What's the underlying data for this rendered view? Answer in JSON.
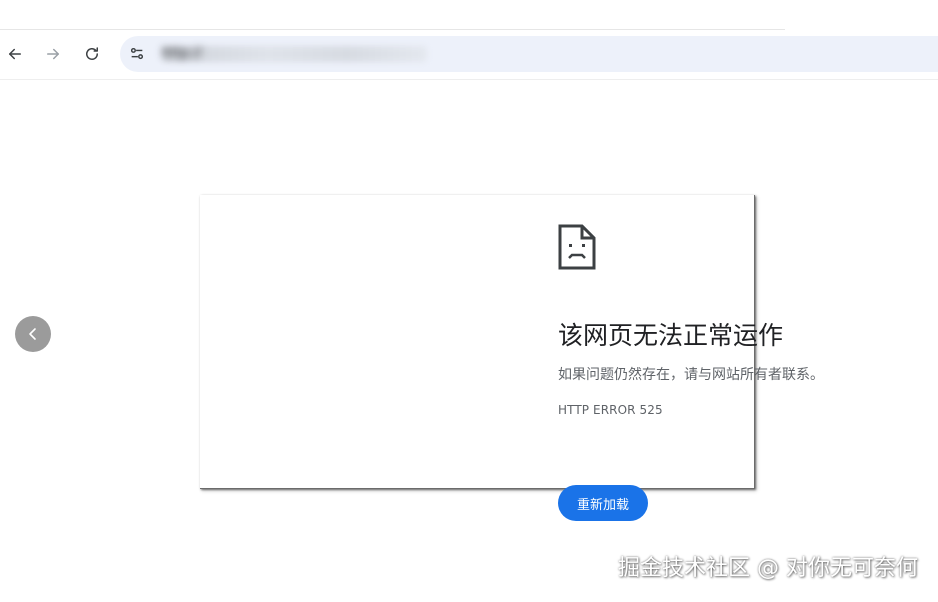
{
  "browser": {
    "address_bar": {
      "url": "http://"
    },
    "nav": {
      "back_icon": "arrow-left-icon",
      "forward_icon": "arrow-right-icon",
      "reload_icon": "reload-icon",
      "site_info_icon": "tune-icon"
    }
  },
  "error_page": {
    "icon": "sad-document-icon",
    "title": "该网页无法正常运作",
    "subtitle": "如果问题仍然存在，请与网站所有者联系。",
    "error_code": "HTTP ERROR 525",
    "reload_button_label": "重新加载",
    "reload_button_color": "#1a73e8"
  },
  "viewer": {
    "prev_icon": "chevron-left-icon"
  },
  "watermark": {
    "text": "掘金技术社区 @ 对你无可奈何"
  }
}
